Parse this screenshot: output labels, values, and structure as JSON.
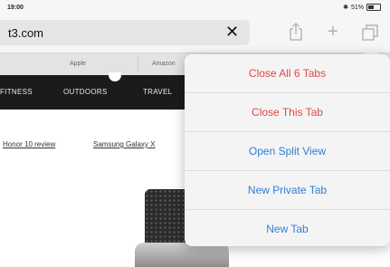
{
  "status_bar": {
    "time": "19:00",
    "battery": "51%",
    "battery_level": 0.51
  },
  "toolbar": {
    "url": "t3.com",
    "share_icon": "share-icon",
    "new_tab_icon": "plus-icon",
    "tabs_icon": "tabs-icon"
  },
  "favorites": [
    "Apple",
    "Amazon"
  ],
  "site_nav": [
    "FITNESS",
    "OUTDOORS",
    "TRAVEL"
  ],
  "links": [
    "Honor 10 review",
    "Samsung Galaxy X"
  ],
  "tab_menu": {
    "items": [
      {
        "label": "Close All 6 Tabs",
        "color": "#e0474c"
      },
      {
        "label": "Close This Tab",
        "color": "#e0474c"
      },
      {
        "label": "Open Split View",
        "color": "#2f7fd4"
      },
      {
        "label": "New Private Tab",
        "color": "#2f7fd4"
      },
      {
        "label": "New Tab",
        "color": "#2f7fd4"
      }
    ]
  }
}
